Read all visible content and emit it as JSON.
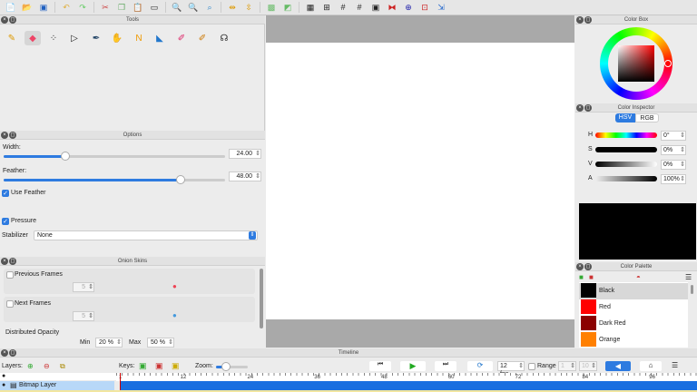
{
  "toolbar": {
    "icons": [
      "new-file-icon",
      "open-folder-icon",
      "save-icon",
      "undo-icon",
      "redo-icon",
      "cut-icon",
      "copy-icon",
      "paste-icon",
      "clear-frame-icon",
      "zoom-in-icon",
      "zoom-out-icon",
      "zoom-fit-icon",
      "flip-horizontal-icon",
      "flip-vertical-icon",
      "preview-icon",
      "toggle-icon",
      "grid-icon",
      "center-icon",
      "grid-3-icon",
      "grid-4-icon",
      "safe-area-icon",
      "camera-path-icon",
      "camera-icon",
      "camera-move-icon",
      "camera-select-icon"
    ]
  },
  "tools": {
    "title": "Tools",
    "items": [
      "pencil",
      "eraser",
      "select",
      "move",
      "pen",
      "hand",
      "polyline",
      "bucket",
      "eyedropper",
      "brush",
      "smudge"
    ],
    "active": "eraser"
  },
  "options": {
    "title": "Options",
    "width_label": "Width:",
    "width_value": "24.00",
    "width_fraction": 0.28,
    "feather_label": "Feather:",
    "feather_value": "48.00",
    "feather_fraction": 0.8,
    "use_feather": "Use Feather",
    "use_feather_checked": true,
    "pressure": "Pressure",
    "pressure_checked": true,
    "stabilizer_label": "Stabilizer",
    "stabilizer_value": "None"
  },
  "onion": {
    "title": "Onion Skins",
    "previous": "Previous Frames",
    "previous_count": "5",
    "next": "Next Frames",
    "next_count": "5",
    "opacity_label": "Distributed Opacity",
    "min_label": "Min",
    "min_value": "20 %",
    "max_label": "Max",
    "max_value": "50 %"
  },
  "colorbox": {
    "title": "Color Box"
  },
  "inspector": {
    "title": "Color Inspector",
    "tabs": [
      "HSV",
      "RGB"
    ],
    "active_tab": "HSV",
    "rows": [
      {
        "label": "H",
        "value": "0°"
      },
      {
        "label": "S",
        "value": "0%"
      },
      {
        "label": "V",
        "value": "0%"
      },
      {
        "label": "A",
        "value": "100%"
      }
    ],
    "preview_color": "#000000"
  },
  "palette": {
    "title": "Color Palette",
    "items": [
      {
        "name": "Black",
        "color": "#000000"
      },
      {
        "name": "Red",
        "color": "#ff0000"
      },
      {
        "name": "Dark Red",
        "color": "#8b0000"
      },
      {
        "name": "Orange",
        "color": "#ff8000"
      }
    ]
  },
  "timeline": {
    "title": "Timeline",
    "layers_label": "Layers:",
    "keys_label": "Keys:",
    "zoom_label": "Zoom:",
    "fps": "12 fps",
    "range_label": "Range",
    "range_start": "1",
    "range_end": "10",
    "ruler": [
      "1",
      "12",
      "24",
      "36",
      "48",
      "60",
      "72",
      "84",
      "96"
    ],
    "layer": "Bitmap Layer"
  },
  "accent": "#2e7be0"
}
